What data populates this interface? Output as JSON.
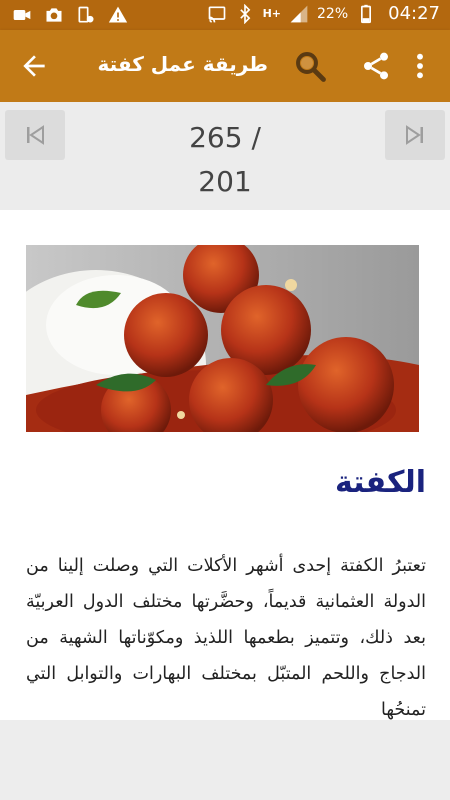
{
  "status_bar": {
    "battery": "22%",
    "time": "04:27",
    "network": "H+",
    "icons": [
      "video-icon",
      "camera-icon",
      "app-icon",
      "warning-icon",
      "cast-icon",
      "bluetooth-icon",
      "signal-icon",
      "battery-icon"
    ]
  },
  "app_bar": {
    "title": "طريقة عمل كفتة ...",
    "icons": [
      "back-arrow-icon",
      "search-icon",
      "share-icon",
      "more-vert-icon"
    ],
    "color": "#c17a17"
  },
  "pager": {
    "current": "265 /",
    "total": "201",
    "icons": [
      "skip-first-icon",
      "skip-last-icon"
    ]
  },
  "article": {
    "title": "الكفتة",
    "body": "تعتبرُ الكفتة إحدى أشهر الأكلات التي وصلت إلينا من الدولة العثمانية قديماً، وحضَّرتها مختلف الدول العربيّة بعد ذلك، وتتميز بطعمها اللذيذ ومكوّناتها الشهية من الدجاج واللحم المتبّل بمختلف البهارات والتوابل التي تمنحُها",
    "title_color": "#1a237e"
  }
}
